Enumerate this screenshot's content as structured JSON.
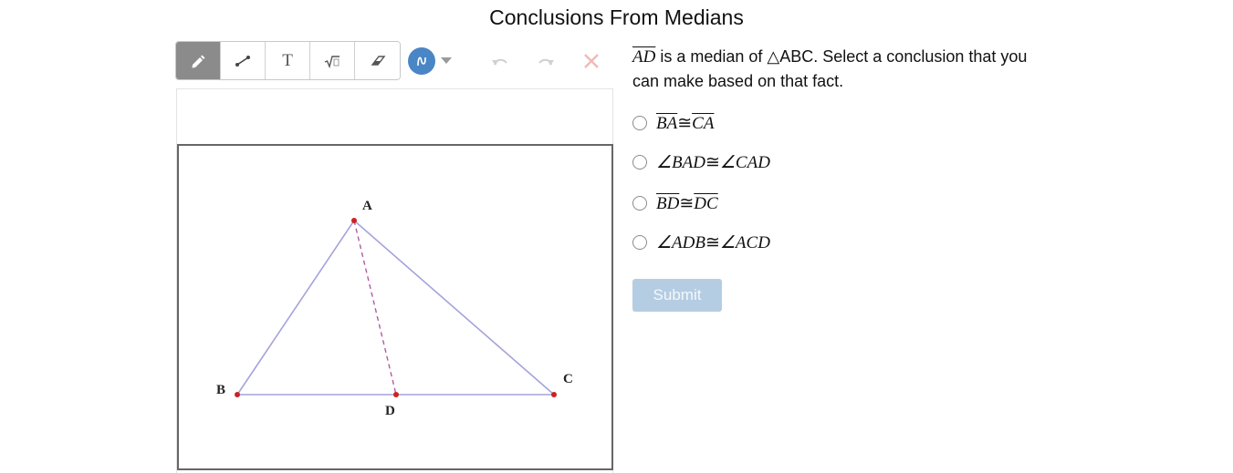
{
  "page": {
    "title": "Conclusions From Medians"
  },
  "toolbar": {
    "tools": [
      {
        "name": "pencil-tool",
        "icon": "pencil-icon",
        "active": true
      },
      {
        "name": "line-tool",
        "icon": "line-segment-icon",
        "active": false
      },
      {
        "name": "text-tool",
        "icon": "text-icon",
        "active": false,
        "glyph": "T"
      },
      {
        "name": "math-tool",
        "icon": "square-root-icon",
        "active": false
      },
      {
        "name": "eraser-tool",
        "icon": "eraser-icon",
        "active": false
      }
    ],
    "pen_color": "#4a86c5",
    "undo_icon": "undo-icon",
    "redo_icon": "redo-icon",
    "clear_icon": "close-icon",
    "clear_color": "#f2b8b8"
  },
  "figure": {
    "labels": {
      "a": "A",
      "b": "B",
      "c": "C",
      "d": "D"
    },
    "side_color": "#a3a3dc",
    "median_color": "#b05aa0",
    "point_color": "#cc2222"
  },
  "question": {
    "segment": "AD",
    "text_before_triangle": "is a median of ",
    "triangle_symbol": "△",
    "text_after_triangle": "ABC.  Select a conclusion that you can make based on that fact."
  },
  "choices": [
    {
      "left": "BA",
      "rel": "≅",
      "right": "CA",
      "kind": "segment"
    },
    {
      "left": "∠BAD",
      "rel": "≅",
      "right": "∠CAD",
      "kind": "angle"
    },
    {
      "left": "BD",
      "rel": "≅",
      "right": "DC",
      "kind": "segment"
    },
    {
      "left": "∠ADB",
      "rel": "≅",
      "right": "∠ACD",
      "kind": "angle"
    }
  ],
  "submit": {
    "label": "Submit",
    "color": "#b4cde3"
  }
}
